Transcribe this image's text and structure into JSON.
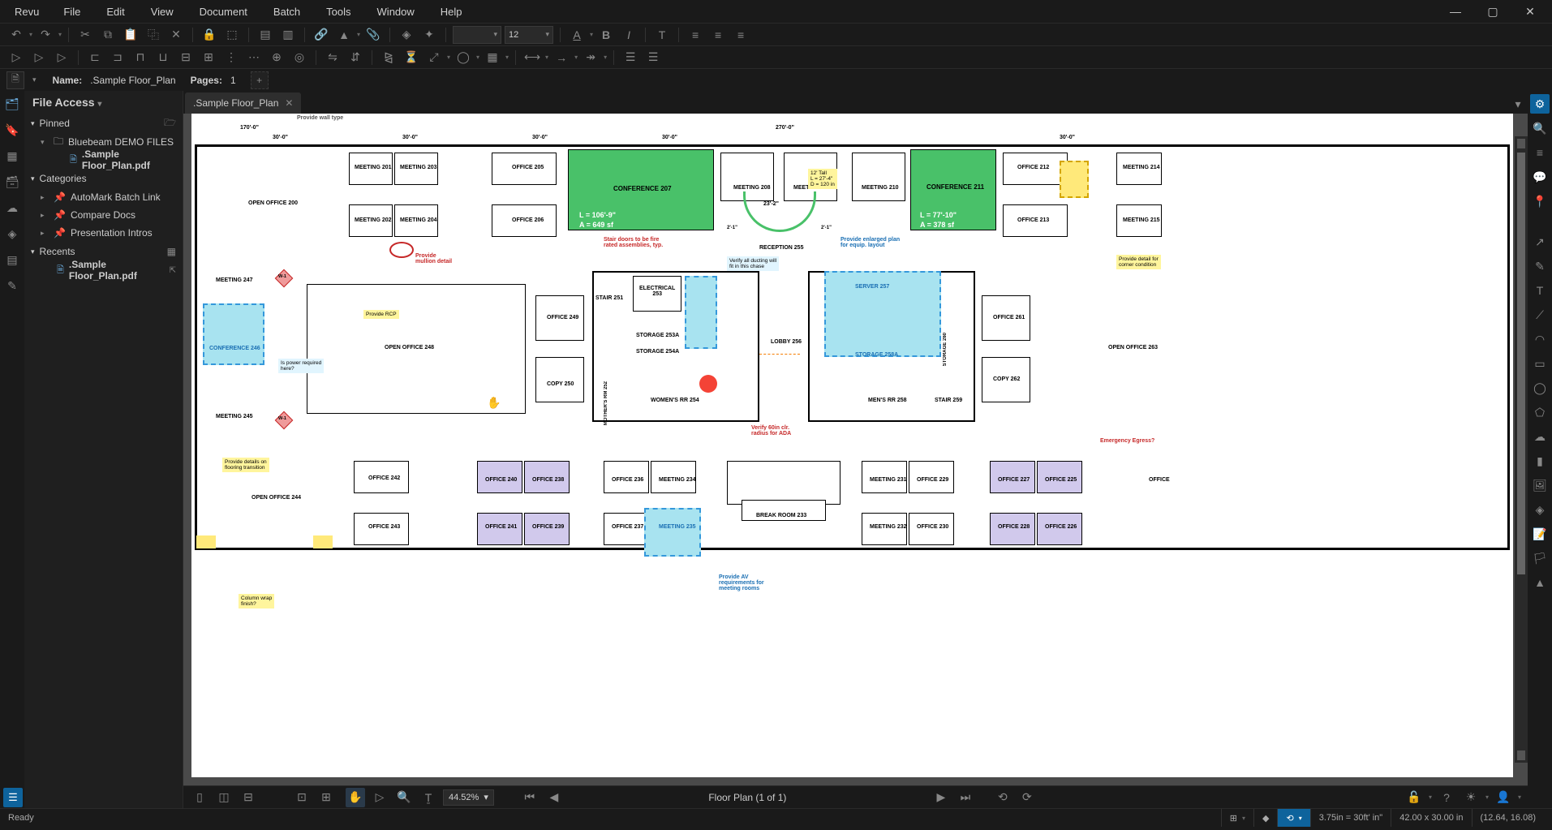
{
  "menu": {
    "brand": "Revu",
    "items": [
      "File",
      "Edit",
      "View",
      "Document",
      "Batch",
      "Tools",
      "Window",
      "Help"
    ]
  },
  "fileinfo": {
    "name_label": "Name:",
    "name_value": ".Sample Floor_Plan",
    "pages_label": "Pages:",
    "pages_value": "1"
  },
  "tabs": {
    "active": ".Sample Floor_Plan"
  },
  "panel": {
    "title": "File Access",
    "sections": {
      "pinned": "Pinned",
      "folder": "Bluebeam DEMO FILES",
      "pinned_file": ".Sample Floor_Plan.pdf",
      "categories": "Categories",
      "cat_items": [
        "AutoMark Batch Link",
        "Compare Docs",
        "Presentation Intros"
      ],
      "recents": "Recents",
      "recent_file": ".Sample Floor_Plan.pdf"
    }
  },
  "toolbar": {
    "font_size": "12"
  },
  "bottom": {
    "zoom": "44.52%",
    "page_label": "Floor Plan (1 of 1)"
  },
  "status": {
    "ready": "Ready",
    "scale": "3.75in = 30ft' in\"",
    "dims": "42.00 x 30.00 in",
    "coords": "(12.64, 16.08)"
  },
  "plan": {
    "dims_top": [
      "170'-0\"",
      "30'-0\"",
      "30'-0\"",
      "30'-0\"",
      "30'-0\"",
      "30'-0\"",
      "270'-0\""
    ],
    "rooms": {
      "open200": "OPEN OFFICE  200",
      "m201": "MEETING  201",
      "m203": "MEETING  203",
      "m202": "MEETING  202",
      "m204": "MEETING  204",
      "o205": "OFFICE  205",
      "o206": "OFFICE  206",
      "conf207": "CONFERENCE  207",
      "conf207_line1": "L = 106'-9\"",
      "conf207_line2": "A = 649 sf",
      "m208": "MEETING  208",
      "m209": "MEETING  209",
      "m210": "MEETING  210",
      "conf211": "CONFERENCE  211",
      "conf211_line1": "L = 77'-10\"",
      "conf211_line2": "A = 378 sf",
      "o212": "OFFICE  212",
      "o213": "OFFICE  213",
      "m214": "MEETING  214",
      "m215": "MEETING  215",
      "recep255": "RECEPTION  255",
      "m247": "MEETING  247",
      "m245": "MEETING  245",
      "conf246": "CONFERENCE  246",
      "open248": "OPEN OFFICE  248",
      "o249": "OFFICE  249",
      "copy250": "COPY  250",
      "stair251": "STAIR  251",
      "elec253": "ELECTRICAL\n253",
      "stor253a": "STORAGE 253A",
      "stor254a": "STORAGE 254A",
      "mothers252": "MOTHER'S RM  252",
      "womens254": "WOMEN'S RR  254",
      "lobby256": "LOBBY  256",
      "server257": "SERVER  257",
      "stor258a": "STORAGE 258A",
      "stor260": "STORAGE  260",
      "mens258": "MEN'S RR  258",
      "stair259": "STAIR  259",
      "o261": "OFFICE  261",
      "copy262": "COPY  262",
      "open263": "OPEN OFFICE  263",
      "open244": "OPEN OFFICE  244",
      "o242": "OFFICE  242",
      "o243": "OFFICE  243",
      "o240": "OFFICE  240",
      "o238": "OFFICE  238",
      "o241": "OFFICE  241",
      "o239": "OFFICE  239",
      "o236": "OFFICE 236",
      "m234": "MEETING  234",
      "o237": "OFFICE 237",
      "m235": "MEETING  235",
      "break233": "BREAK ROOM  233",
      "m231": "MEETING  231",
      "o229": "OFFICE  229",
      "m232": "MEETING  232",
      "o230": "OFFICE  230",
      "o227": "OFFICE  227",
      "o225": "OFFICE  225",
      "o228": "OFFICE  228",
      "o226": "OFFICE  226",
      "office_r": "OFFICE"
    },
    "notes": {
      "walltype": "Provide wall type",
      "mullion": "Provide\nmullion detail",
      "firerated": "Stair doors to be fire\nrated assemblies, typ.",
      "ducting": "Verify all ducting will\nfit in this chase",
      "enlarged": "Provide enlarged plan\nfor equip. layout",
      "cornerdetail": "Provide detail for\ncorner condition",
      "rcp": "Provide RCP",
      "power": "Is power required\nhere?",
      "flooring": "Provide details on\nflooring transition",
      "ada": "Verify 60in clr.\nradius for ADA",
      "egress": "Emergency Egress?",
      "av": "Provide AV\nrequirements for\nmeeting rooms",
      "colwrap": "Column wrap\nfinish?",
      "tall_callout": "12' Tall\nL = 27'-4\"\nD = 120 in",
      "dim23_2": "23'-2\"",
      "dim2_1a": "2'-1\"",
      "dim2_1b": "2'-1\"",
      "w1a": "W-1",
      "w1b": "W-1"
    }
  }
}
